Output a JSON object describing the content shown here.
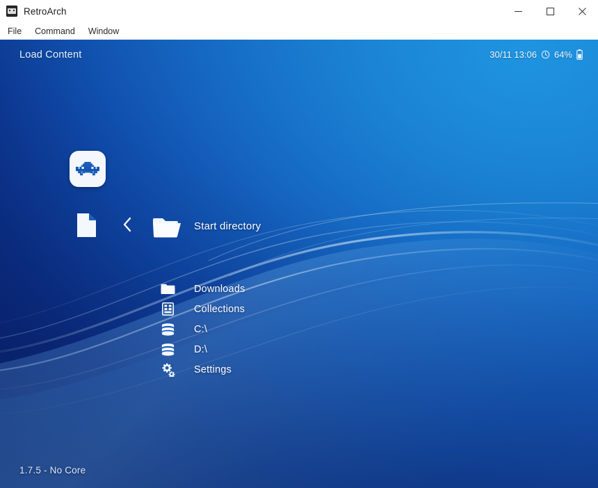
{
  "window": {
    "title": "RetroArch",
    "icon": "retroarch-icon",
    "controls": [
      {
        "name": "minimize-button",
        "glyph": "minimize-icon",
        "label": "Minimize"
      },
      {
        "name": "maximize-button",
        "glyph": "maximize-icon",
        "label": "Maximize"
      },
      {
        "name": "close-button",
        "glyph": "close-icon",
        "label": "Close"
      }
    ]
  },
  "menubar": {
    "items": [
      {
        "label": "File"
      },
      {
        "label": "Command"
      },
      {
        "label": "Window"
      }
    ]
  },
  "xmb": {
    "header": {
      "tab_label": "Load Content",
      "datetime": "30/11 13:06",
      "clock_icon": "clock-icon",
      "battery_percent": "64%",
      "battery_icon": "battery-icon"
    },
    "logo": {
      "icon": "retroarch-logo-icon"
    },
    "navigation": {
      "left_icon": "file-page-icon",
      "back_icon": "chevron-left-icon",
      "current_icon": "folder-open-icon",
      "current_label": "Start directory"
    },
    "entries": [
      {
        "label": "Downloads",
        "icon": "folder-icon"
      },
      {
        "label": "Collections",
        "icon": "grid-list-icon"
      },
      {
        "label": "C:\\",
        "icon": "drive-database-icon"
      },
      {
        "label": "D:\\",
        "icon": "drive-database-icon"
      },
      {
        "label": "Settings",
        "icon": "gears-icon"
      }
    ],
    "footer": {
      "status": "1.7.5 - No Core"
    }
  },
  "colors": {
    "accent_top_right": "#1f93e0",
    "accent_bottom_left": "#0a2068",
    "text_primary": "#ffffff",
    "close_hover": "#e81123"
  }
}
